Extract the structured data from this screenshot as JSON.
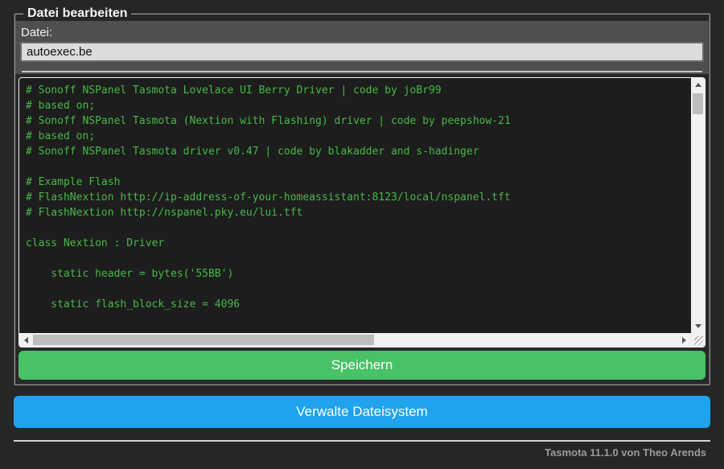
{
  "window": {
    "legend": "Datei bearbeiten"
  },
  "form": {
    "file_label": "Datei:",
    "filename": "autoexec.be"
  },
  "editor": {
    "code_lines": [
      "# Sonoff NSPanel Tasmota Lovelace UI Berry Driver | code by joBr99",
      "# based on;",
      "# Sonoff NSPanel Tasmota (Nextion with Flashing) driver | code by peepshow-21",
      "# based on;",
      "# Sonoff NSPanel Tasmota driver v0.47 | code by blakadder and s-hadinger",
      "",
      "# Example Flash",
      "# FlashNextion http://ip-address-of-your-homeassistant:8123/local/nspanel.tft",
      "# FlashNextion http://nspanel.pky.eu/lui.tft",
      "",
      "class Nextion : Driver",
      "",
      "    static header = bytes('55BB')",
      "",
      "    static flash_block_size = 4096"
    ]
  },
  "buttons": {
    "save": "Speichern",
    "manage_filesystem": "Verwalte Dateisystem"
  },
  "footer": {
    "version_text": "Tasmota 11.1.0 von Theo Arends"
  },
  "colors": {
    "page_background": "#262626",
    "form_background": "#4f4f4f",
    "editor_background": "#1d1d1d",
    "code_text": "#46b946",
    "save_button": "#47c266",
    "manage_button": "#1fa3ec",
    "text": "#eaeaea"
  }
}
